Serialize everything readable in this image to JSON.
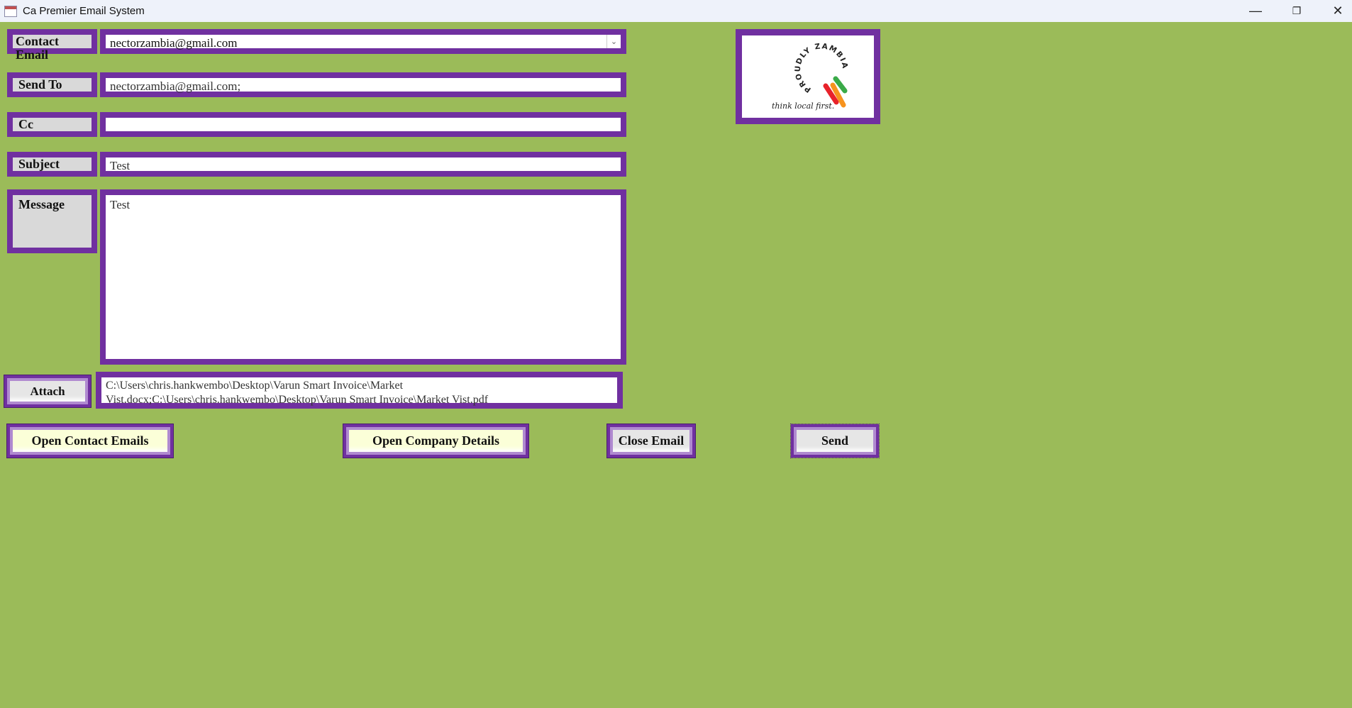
{
  "window": {
    "title": "Ca Premier Email System",
    "minimize": "—",
    "restore": "❐",
    "close": "✕"
  },
  "form": {
    "contact_email": {
      "label": "Contact Email",
      "value": "nectorzambia@gmail.com",
      "dropdown": "⌄"
    },
    "send_to": {
      "label": "Send To",
      "value": "nectorzambia@gmail.com;"
    },
    "cc": {
      "label": "Cc",
      "value": ""
    },
    "subject": {
      "label": "Subject",
      "value": "Test"
    },
    "message": {
      "label": "Message",
      "value": "Test"
    },
    "attach": {
      "label": "Attach",
      "line1": "C:\\Users\\chris.hankwembo\\Desktop\\Varun Smart Invoice\\Market",
      "line2": "Vist.docx;C:\\Users\\chris.hankwembo\\Desktop\\Varun Smart Invoice\\Market Vist.pdf"
    }
  },
  "buttons": {
    "open_contacts": "Open Contact Emails",
    "open_company": "Open Company Details",
    "close_email": "Close Email",
    "send": "Send"
  },
  "logo": {
    "arc_text": "PROUDLY ZAMBIAN",
    "tagline": "think local first.",
    "colors": {
      "red": "#e8222a",
      "green": "#3aaa48",
      "orange": "#f7931e"
    }
  }
}
